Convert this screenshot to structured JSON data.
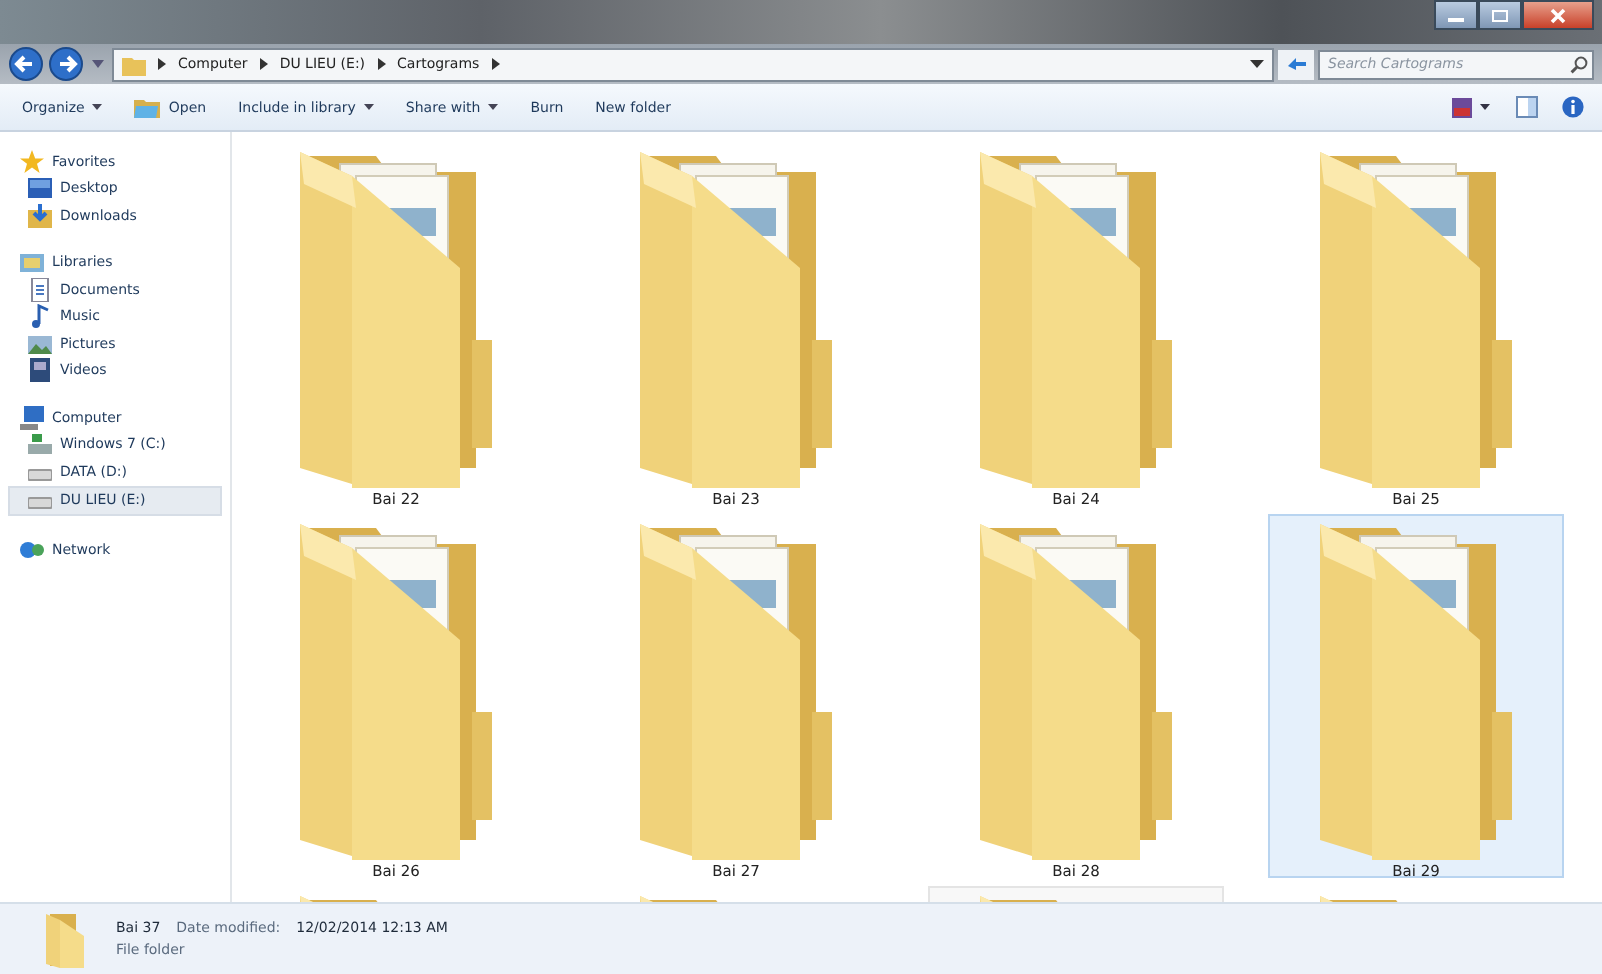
{
  "address_bar": {
    "path": [
      "Computer",
      "DU LIEU (E:)",
      "Cartograms"
    ]
  },
  "search": {
    "placeholder": "Search Cartograms"
  },
  "toolbar": [
    {
      "label": "Organize",
      "kind": "menu"
    },
    {
      "label": "Open",
      "kind": "icon"
    },
    {
      "label": "Include in library",
      "kind": "menu"
    },
    {
      "label": "Share with",
      "kind": "menu"
    },
    {
      "label": "Burn",
      "kind": "plain"
    },
    {
      "label": "New folder",
      "kind": "plain"
    }
  ],
  "sidebar": [
    {
      "label": "Favorites",
      "selected": false,
      "children": [
        {
          "label": "Desktop",
          "selected": false
        },
        {
          "label": "Downloads",
          "selected": false
        }
      ]
    },
    {
      "label": "Libraries",
      "selected": false,
      "children": [
        {
          "label": "Documents",
          "selected": false
        },
        {
          "label": "Music",
          "selected": false
        },
        {
          "label": "Pictures",
          "selected": false
        },
        {
          "label": "Videos",
          "selected": false
        }
      ]
    },
    {
      "label": "Computer",
      "selected": false,
      "children": [
        {
          "label": "Windows 7 (C:)",
          "selected": false
        },
        {
          "label": "DATA (D:)",
          "selected": false
        },
        {
          "label": "DU LIEU (E:)",
          "selected": true
        }
      ]
    },
    {
      "label": "Network",
      "selected": false
    }
  ],
  "folders": [
    {
      "label": "Bai 22",
      "selected": false,
      "hovered": false
    },
    {
      "label": "Bai 23",
      "selected": false,
      "hovered": false
    },
    {
      "label": "Bai 24",
      "selected": false,
      "hovered": false
    },
    {
      "label": "Bai 25",
      "selected": false,
      "hovered": false
    },
    {
      "label": "Bai 26",
      "selected": false,
      "hovered": false
    },
    {
      "label": "Bai 27",
      "selected": false,
      "hovered": false
    },
    {
      "label": "Bai 28",
      "selected": false,
      "hovered": false
    },
    {
      "label": "Bai 29",
      "selected": true,
      "hovered": false
    },
    {
      "selected": false,
      "hovered": false
    },
    {
      "selected": false,
      "hovered": false
    },
    {
      "selected": false,
      "hovered": true
    },
    {
      "selected": false,
      "hovered": false
    }
  ],
  "details": {
    "name": "Bai 37",
    "date_label": "Date modified:",
    "date": "12/02/2014 12:13 AM",
    "type": "File folder"
  }
}
